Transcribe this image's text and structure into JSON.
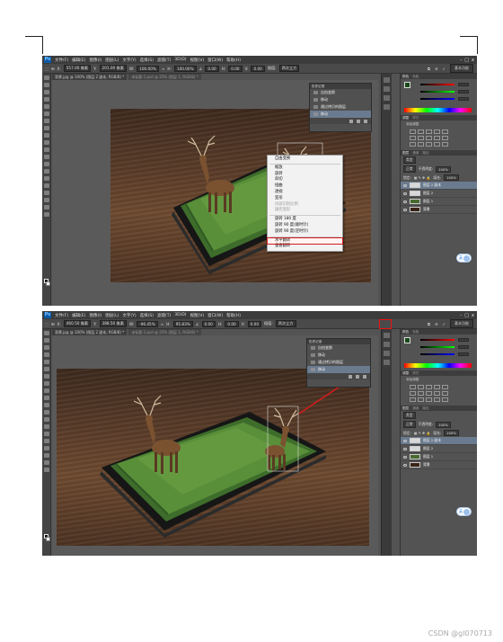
{
  "menubar": {
    "logo": "Ps",
    "items": [
      "文件(F)",
      "编辑(E)",
      "图像(I)",
      "图层(L)",
      "文字(Y)",
      "选择(S)",
      "滤镜(T)",
      "3D(D)",
      "视图(V)",
      "窗口(W)",
      "帮助(H)"
    ],
    "window_buttons": [
      "-",
      "□",
      "x"
    ]
  },
  "shot1": {
    "options": {
      "x_label": "X:",
      "x_value": "557.00 像素",
      "y_label": "Y:",
      "y_value": "201.00 像素",
      "w_label": "W:",
      "w_value": "100.00%",
      "h_label": "H:",
      "h_value": "100.00%",
      "angle_value": "0.00",
      "hskew_label": "H:",
      "hskew_value": "0.00",
      "vskew_label": "V:",
      "vskew_value": "0.00",
      "interp_label": "插值:",
      "interp_value": "两次立方",
      "workspace": "基本功能"
    },
    "tabs": [
      "背景.jpg @ 100% (图层 2 副本, RGB/8) *",
      "未标题-1.psd @ 25% (图层 1, RGB/8) *"
    ],
    "history": {
      "title": "历史记录",
      "items": [
        "自由变换",
        "移动",
        "通过拷贝的图层",
        "移动"
      ],
      "selected": 3
    },
    "context_menu": {
      "items": [
        "自由变换",
        "缩放",
        "旋转",
        "斜切",
        "扭曲",
        "透视",
        "变形",
        "内容识别比例",
        "操控变形",
        "旋转 180 度",
        "旋转 90 度(顺时针)",
        "旋转 90 度(逆时针)",
        "水平翻转",
        "垂直翻转"
      ],
      "disabled": [
        7,
        8
      ],
      "highlight": 12
    },
    "layers": {
      "tabs": [
        "图层",
        "通道",
        "路径"
      ],
      "kind": "类型",
      "blend": "正常",
      "opacity_label": "不透明度:",
      "opacity_value": "100%",
      "lock_label": "锁定:",
      "fill_label": "填充:",
      "fill_value": "100%",
      "rows": [
        {
          "name": "图层 2 副本",
          "thumb": "light",
          "selected": true
        },
        {
          "name": "图层 2",
          "thumb": "light",
          "selected": false
        },
        {
          "name": "图层 1",
          "thumb": "green",
          "selected": false
        },
        {
          "name": "背景",
          "thumb": "dark",
          "selected": false
        }
      ]
    },
    "panels": {
      "color_tabs": [
        "颜色",
        "色板"
      ],
      "adj_tabs": [
        "调整",
        "样式"
      ],
      "adj_add": "添加调整"
    },
    "chat_label": "英"
  },
  "shot2": {
    "options": {
      "x_label": "X:",
      "x_value": "460.50 像素",
      "y_label": "Y:",
      "y_value": "388.50 像素",
      "w_label": "W:",
      "w_value": "-96.45%",
      "h_label": "H:",
      "h_value": "95.83%",
      "angle_value": "0.00",
      "hskew_label": "H:",
      "hskew_value": "0.00",
      "vskew_label": "V:",
      "vskew_value": "0.00",
      "interp_label": "插值:",
      "interp_value": "两次立方",
      "workspace": "基本功能"
    },
    "tabs": [
      "背景.jpg @ 100% (图层 2 副本, RGB/8) *",
      "未标题-1.psd @ 25% (图层 1, RGB/8) *"
    ],
    "history": {
      "title": "历史记录",
      "items": [
        "自由变换",
        "移动",
        "通过拷贝的图层",
        "移动"
      ],
      "selected": 3
    },
    "layers": {
      "tabs": [
        "图层",
        "通道",
        "路径"
      ],
      "kind": "类型",
      "blend": "正常",
      "opacity_label": "不透明度:",
      "opacity_value": "100%",
      "lock_label": "锁定:",
      "fill_label": "填充:",
      "fill_value": "100%",
      "rows": [
        {
          "name": "图层 2 副本",
          "thumb": "light",
          "selected": true
        },
        {
          "name": "图层 2",
          "thumb": "light",
          "selected": false
        },
        {
          "name": "图层 1",
          "thumb": "green",
          "selected": false
        },
        {
          "name": "背景",
          "thumb": "dark",
          "selected": false
        }
      ]
    },
    "panels": {
      "color_tabs": [
        "颜色",
        "色板"
      ],
      "adj_tabs": [
        "调整",
        "样式"
      ],
      "adj_add": "添加调整"
    },
    "chat_label": "英"
  },
  "colors": {
    "highlight_red": "#d21c1c",
    "selected_row": "#6b7b8f",
    "ps_blue": "#0d5aa7"
  },
  "footer": {
    "watermark": "CSDN @gl070713"
  }
}
